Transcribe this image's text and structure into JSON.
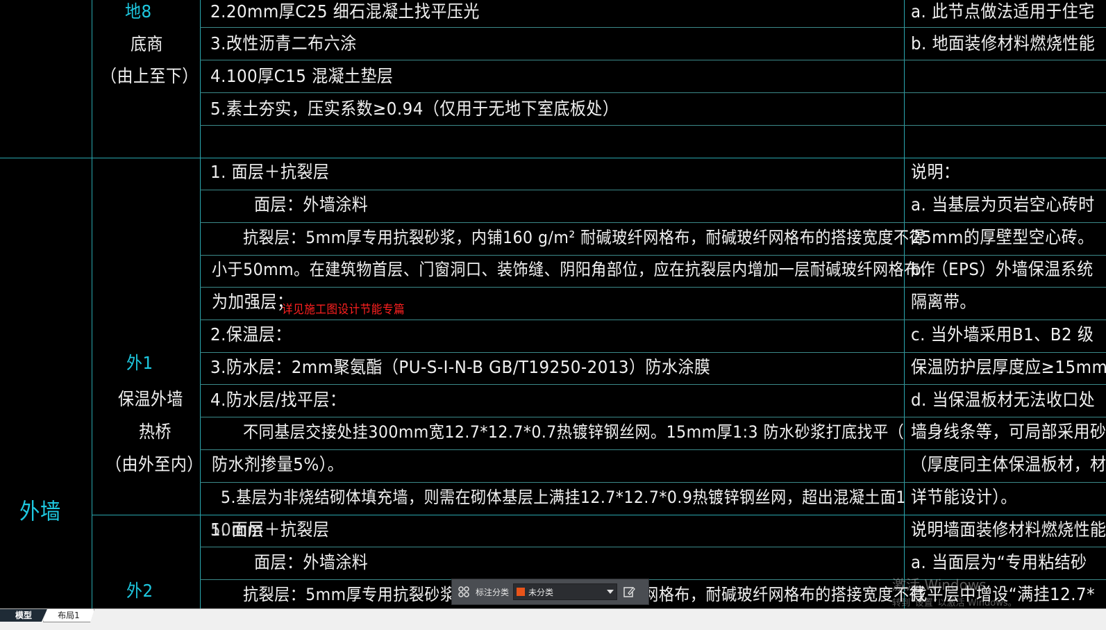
{
  "drawing": {
    "section1": {
      "code": "地8",
      "name": "底商",
      "order": "（由上至下）",
      "rows": [
        "2.20mm厚C25 细石混凝土找平压光",
        "3.改性沥青二布六涂",
        "4.100厚C15 混凝土垫层",
        "5.素土夯实，压实系数≥0.94（仅用于无地下室底板处）",
        ""
      ],
      "notes": [
        "a. 此节点做法适用于住宅",
        "b. 地面装修材料燃烧性能"
      ]
    },
    "group_label": "外墙",
    "section2": {
      "code": "外1",
      "name": "保温外墙",
      "name2": "热桥",
      "order": "（由外至内）",
      "rows": [
        "1. 面层＋抗裂层",
        "面层：外墙涂料",
        "抗裂层：5mm厚专用抗裂砂浆，内铺160 g/m² 耐碱玻纤网格布，耐碱玻纤网格布的搭接宽度不得",
        "小于50mm。在建筑物首层、门窗洞口、装饰缝、阴阳角部位，应在抗裂层内增加一层耐碱玻纤网格布作",
        "为加强层；",
        "2.保温层：",
        "3.防水层：2mm聚氨酯（PU-S-I-N-B  GB/T19250-2013）防水涂膜",
        "4.防水层/找平层：",
        "不同基层交接处挂300mm宽12.7*12.7*0.7热镀锌钢丝网。15mm厚1:3 防水砂浆打底找平（",
        "防水剂掺量5%）。",
        "5.基层为非烧结砌体填充墙，则需在砌体基层上满挂12.7*12.7*0.9热镀锌钢丝网，超出混凝土面1"
      ],
      "red_note": "详见施工图设计节能专篇",
      "notes": [
        "说明：",
        "a. 当基层为页岩空心砖时",
        "25mm的厚壁型空心砖。",
        "b. （EPS）外墙保温系统",
        "隔离带。",
        "c. 当外墙采用B1、B2 级",
        "保温防护层厚度应≥15mm",
        "d. 当保温板材无法收口处",
        "墙身线条等，可局部采用砂",
        "（厚度同主体保温板材，材",
        "详节能设计）。"
      ]
    },
    "section3": {
      "code": "外2",
      "rows": [
        "1. 面层＋抗裂层",
        "面层：外墙涂料",
        "抗裂层：5mm厚专用抗裂砂浆，内铺160 g/m² 耐碱玻纤网格布，耐碱玻纤网格布的搭接宽度不得",
        "50mm"
      ],
      "notes": [
        "说明墙面装修材料燃烧性能",
        "a. 当面层为“专用粘结砂",
        "找平层中增设“满挂12.7*"
      ]
    }
  },
  "toolbar": {
    "label": "标注分类",
    "selected": "未分类",
    "swatch_color": "#e8541a"
  },
  "tabs": [
    "模型",
    "布局1"
  ],
  "watermark": {
    "line1": "激活 Windows",
    "line2": "转到“设置”以激活 Windows。"
  }
}
